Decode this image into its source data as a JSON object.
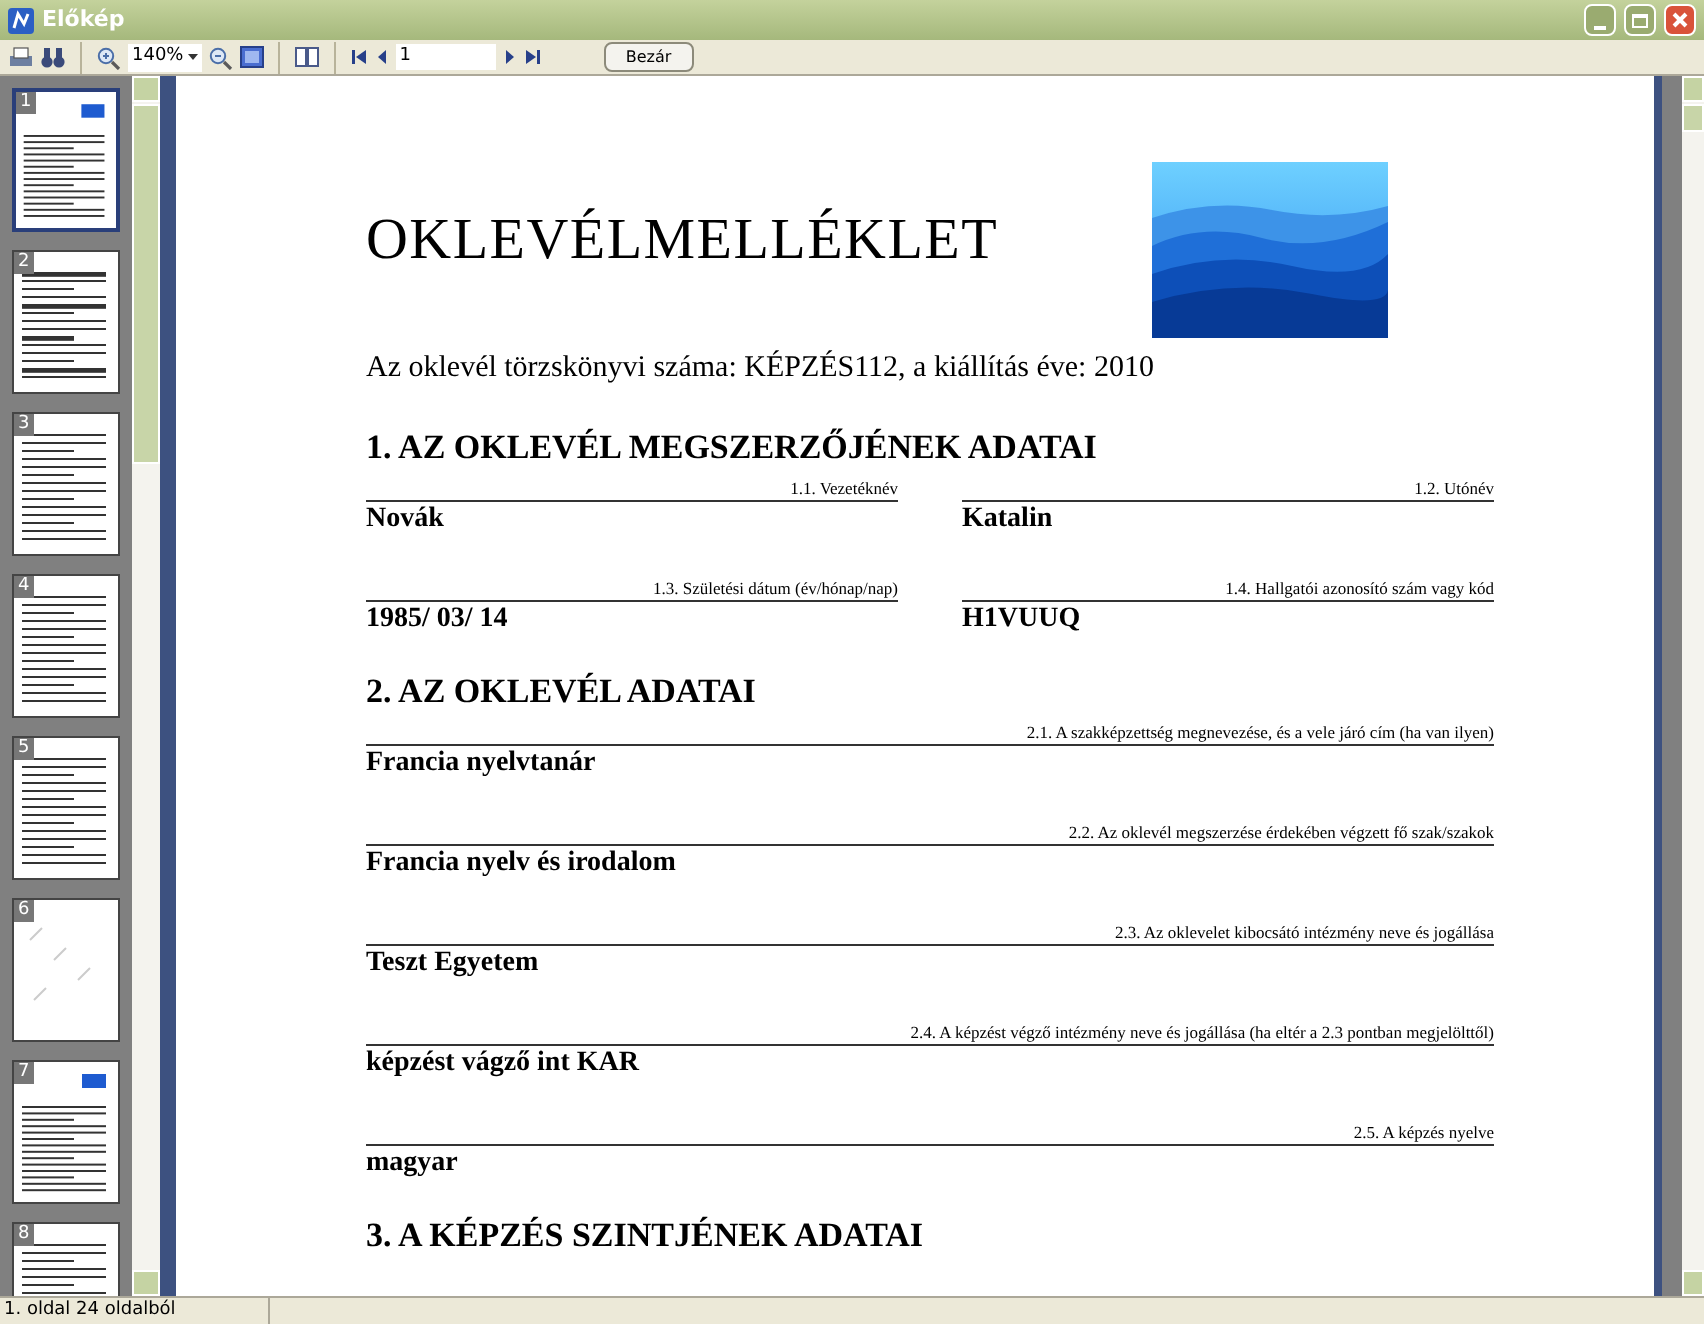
{
  "window": {
    "title": "Előkép"
  },
  "toolbar": {
    "zoom": "140%",
    "page": "1",
    "close_button": "Bezár"
  },
  "thumbnails": [
    {
      "label": "1",
      "selected": true,
      "kind": "cover"
    },
    {
      "label": "2",
      "selected": false,
      "kind": "table"
    },
    {
      "label": "3",
      "selected": false,
      "kind": "text"
    },
    {
      "label": "4",
      "selected": false,
      "kind": "text"
    },
    {
      "label": "5",
      "selected": false,
      "kind": "text"
    },
    {
      "label": "6",
      "selected": false,
      "kind": "blank"
    },
    {
      "label": "7",
      "selected": false,
      "kind": "cover"
    },
    {
      "label": "8",
      "selected": false,
      "kind": "text"
    }
  ],
  "document": {
    "title": "OKLEVÉLMELLÉKLET",
    "subtitle": "Az oklevél törzskönyvi száma: KÉPZÉS112, a kiállítás éve: 2010",
    "sections": [
      {
        "heading": "1. AZ OKLEVÉL MEGSZERZŐJÉNEK ADATAI",
        "field_rows": [
          [
            {
              "label": "1.1. Vezetéknév",
              "value": "Novák"
            },
            {
              "label": "1.2. Utónév",
              "value": "Katalin"
            }
          ],
          [
            {
              "label": "1.3. Születési dátum (év/hónap/nap)",
              "value": "1985/ 03/ 14"
            },
            {
              "label": "1.4. Hallgatói azonosító szám vagy kód",
              "value": "H1VUUQ"
            }
          ]
        ]
      },
      {
        "heading": "2. AZ OKLEVÉL ADATAI",
        "field_rows": [
          [
            {
              "label": "2.1. A szakképzettség megnevezése, és a vele járó cím (ha van ilyen)",
              "value": "Francia nyelvtanár"
            }
          ],
          [
            {
              "label": "2.2. Az oklevél megszerzése érdekében végzett fő szak/szakok",
              "value": "Francia nyelv és irodalom"
            }
          ],
          [
            {
              "label": "2.3. Az oklevelet kibocsátó intézmény neve és jogállása",
              "value": "Teszt Egyetem"
            }
          ],
          [
            {
              "label": "2.4. A képzést végző intézmény neve és jogállása (ha eltér a 2.3 pontban megjelölttől)",
              "value": "képzést vágző int KAR"
            }
          ],
          [
            {
              "label": "2.5. A képzés nyelve",
              "value": "magyar"
            }
          ]
        ]
      },
      {
        "heading": "3. A KÉPZÉS SZINTJÉNEK ADATAI"
      }
    ]
  },
  "status_bar": {
    "text": "1. oldal 24 oldalból"
  }
}
